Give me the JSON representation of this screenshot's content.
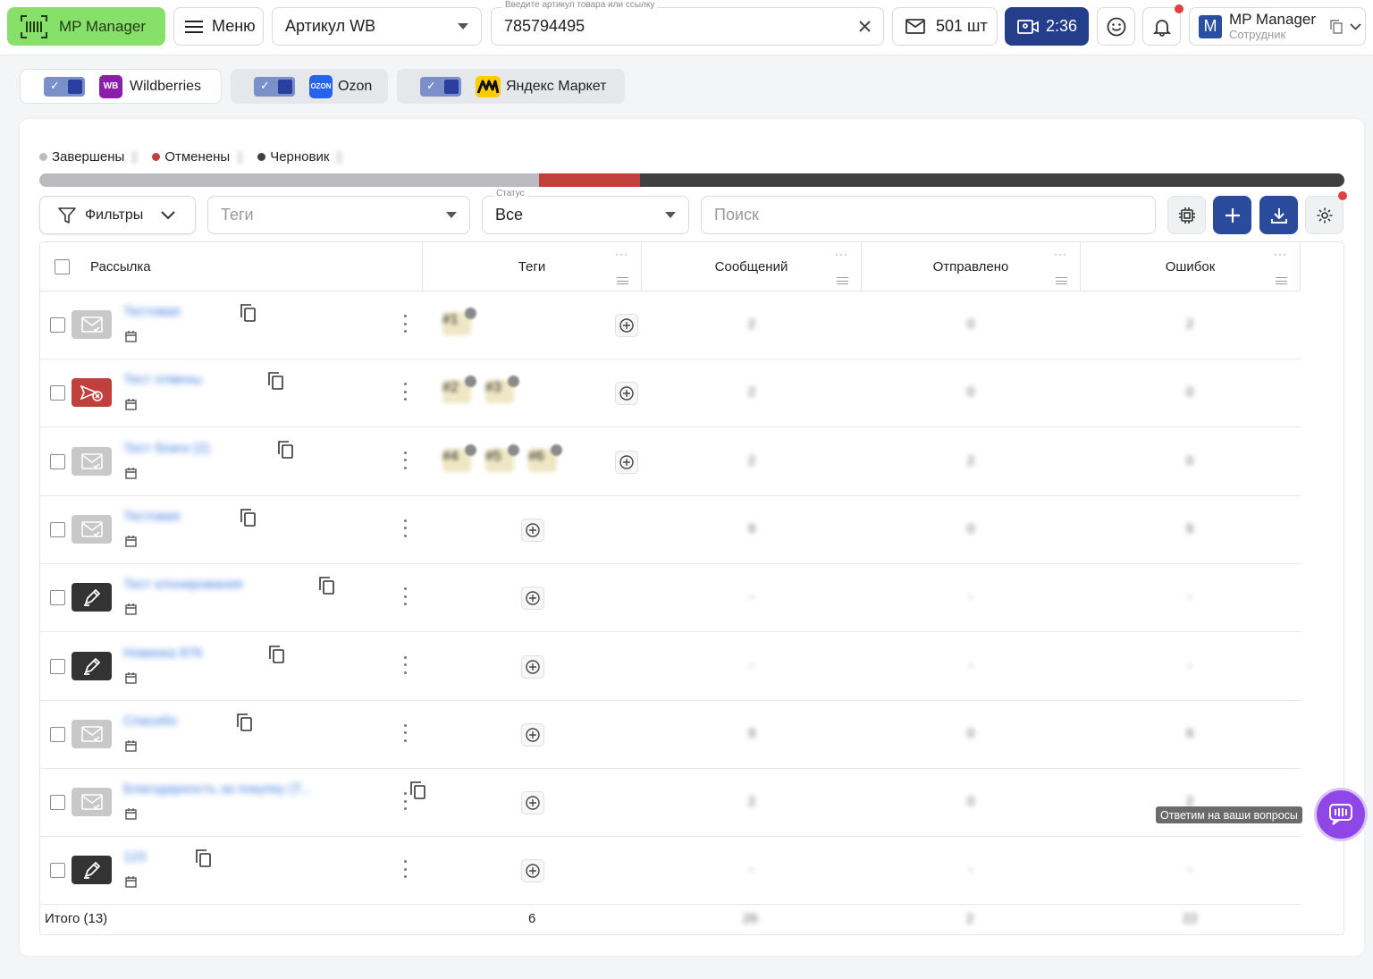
{
  "header": {
    "logo_label": "MP Manager",
    "menu_label": "Меню",
    "article_select": "Артикул WB",
    "article_input_label": "Введите артикул товара или ссылку",
    "article_input_value": "785794495",
    "pcs_label": "501 шт",
    "timer_label": "2:36",
    "user_name": "MP Manager",
    "user_role": "Сотрудник",
    "user_avatar": "M"
  },
  "marketplaces": [
    {
      "name": "Wildberries",
      "logo": "WB",
      "color": "#8b1fa9"
    },
    {
      "name": "Ozon",
      "logo": "OZON",
      "color": "#2563eb"
    },
    {
      "name": "Яндекс Маркет",
      "logo": "YM",
      "color": "#ffcc00"
    }
  ],
  "legend": {
    "completed": "Завершены",
    "cancelled": "Отменены",
    "draft": "Черновик"
  },
  "progress": {
    "completed": 0.383,
    "cancelled": 0.077,
    "draft": 0.54
  },
  "colors": {
    "completed": "#b9bbbe",
    "cancelled": "#c0403b",
    "draft": "#3f3f3f",
    "accent": "#2a4a9c",
    "chat": "#8e46e6"
  },
  "filters": {
    "filters_label": "Фильтры",
    "tags_placeholder": "Теги",
    "status_label": "Статус",
    "status_value": "Все",
    "search_placeholder": "Поиск"
  },
  "table": {
    "columns": [
      "Рассылка",
      "Теги",
      "Сообщений",
      "Отправлено",
      "Ошибок"
    ],
    "rows": [
      {
        "name": "Тестовая",
        "icon": "mail-icon",
        "tags": [
          "#1"
        ],
        "messages": "2",
        "sent": "0",
        "errors": "2"
      },
      {
        "name": "Тест отмены",
        "icon": "cancel-mail-icon",
        "tags": [
          "#2",
          "#3"
        ],
        "messages": "2",
        "sent": "0",
        "errors": "0"
      },
      {
        "name": "Тест благи (2)",
        "icon": "mail-icon",
        "tags": [
          "#4",
          "#5",
          "#6"
        ],
        "messages": "2",
        "sent": "2",
        "errors": "0"
      },
      {
        "name": "Тестовая",
        "icon": "mail-icon",
        "tags": [],
        "messages": "9",
        "sent": "0",
        "errors": "9"
      },
      {
        "name": "Тест клонирования",
        "icon": "draft-icon",
        "tags": [],
        "messages": "-",
        "sent": "-",
        "errors": "-"
      },
      {
        "name": "Новинка 876",
        "icon": "draft-icon",
        "tags": [],
        "messages": "-",
        "sent": "-",
        "errors": "-"
      },
      {
        "name": "Спасибо",
        "icon": "mail-icon",
        "tags": [],
        "messages": "9",
        "sent": "0",
        "errors": "9"
      },
      {
        "name": "Благодарность за покупку (Т...",
        "icon": "mail-icon",
        "tags": [],
        "messages": "2",
        "sent": "0",
        "errors": "2"
      },
      {
        "name": "123",
        "icon": "draft-icon",
        "tags": [],
        "messages": "-",
        "sent": "-",
        "errors": "-"
      }
    ],
    "totals": {
      "label": "Итого (13)",
      "tags": "6",
      "messages": "26",
      "sent": "2",
      "errors": "22"
    }
  },
  "chat": {
    "tooltip": "Ответим на ваши вопросы"
  }
}
